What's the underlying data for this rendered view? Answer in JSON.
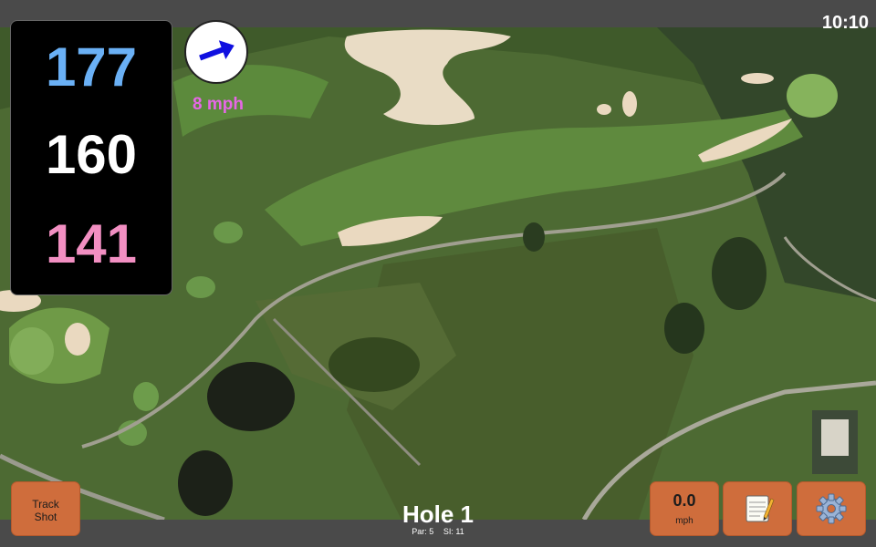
{
  "status": {
    "time": "10:10"
  },
  "distances": {
    "back": "177",
    "middle": "160",
    "front": "141",
    "colors": {
      "back": "#6ab0f5",
      "middle": "#ffffff",
      "front": "#f28fc2"
    }
  },
  "wind": {
    "speed_label": "8 mph",
    "arrow_color": "#1010e0",
    "label_color": "#e667e6",
    "direction_icon": "arrow-right-up-icon"
  },
  "hole": {
    "title": "Hole 1",
    "par": "Par: 5",
    "stroke_index": "SI: 11"
  },
  "buttons": {
    "track_shot": {
      "line1": "Track",
      "line2": "Shot"
    },
    "wind_speed": {
      "value": "0.0",
      "unit": "mph"
    },
    "notes": {
      "icon": "notepad-icon"
    },
    "settings": {
      "icon": "gear-icon"
    },
    "accent": "#cf6d3c"
  },
  "map": {
    "description_icon": "satellite-map"
  }
}
